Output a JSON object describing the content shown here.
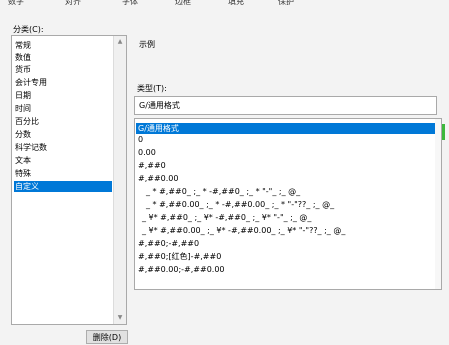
{
  "tabs": [
    "数字",
    "对齐",
    "字体",
    "边框",
    "填充",
    "保护"
  ],
  "category": {
    "label": "分类(C):",
    "items": [
      "常规",
      "数值",
      "货币",
      "会计专用",
      "日期",
      "时间",
      "百分比",
      "分数",
      "科学记数",
      "文本",
      "特殊",
      "自定义"
    ],
    "selected_index": 11
  },
  "sample": {
    "label": "示例",
    "value": ""
  },
  "type": {
    "label": "类型(T):",
    "input_value": "G/通用格式",
    "items": [
      "G/通用格式",
      "0",
      "0.00",
      "#,##0",
      "#,##0.00",
      "_ * #,##0_ ;_ * -#,##0_ ;_ * \"-\"_ ;_ @_",
      "_ * #,##0.00_ ;_ * -#,##0.00_ ;_ * \"-\"??_ ;_ @_",
      "_ ¥* #,##0_ ;_ ¥* -#,##0_ ;_ ¥* \"-\"_ ;_ @_",
      "_ ¥* #,##0.00_ ;_ ¥* -#,##0.00_ ;_ ¥* \"-\"??_ ;_ @_",
      "#,##0;-#,##0",
      "#,##0;[红色]-#,##0",
      "#,##0.00;-#,##0.00"
    ],
    "selected_index": 0
  },
  "scroll_up_icon": "triangle-up",
  "scroll_down_icon": "triangle-down",
  "delete_button": "删除(D)",
  "colors": {
    "selection": "#0078d7",
    "accent_green": "#3cb83c"
  }
}
